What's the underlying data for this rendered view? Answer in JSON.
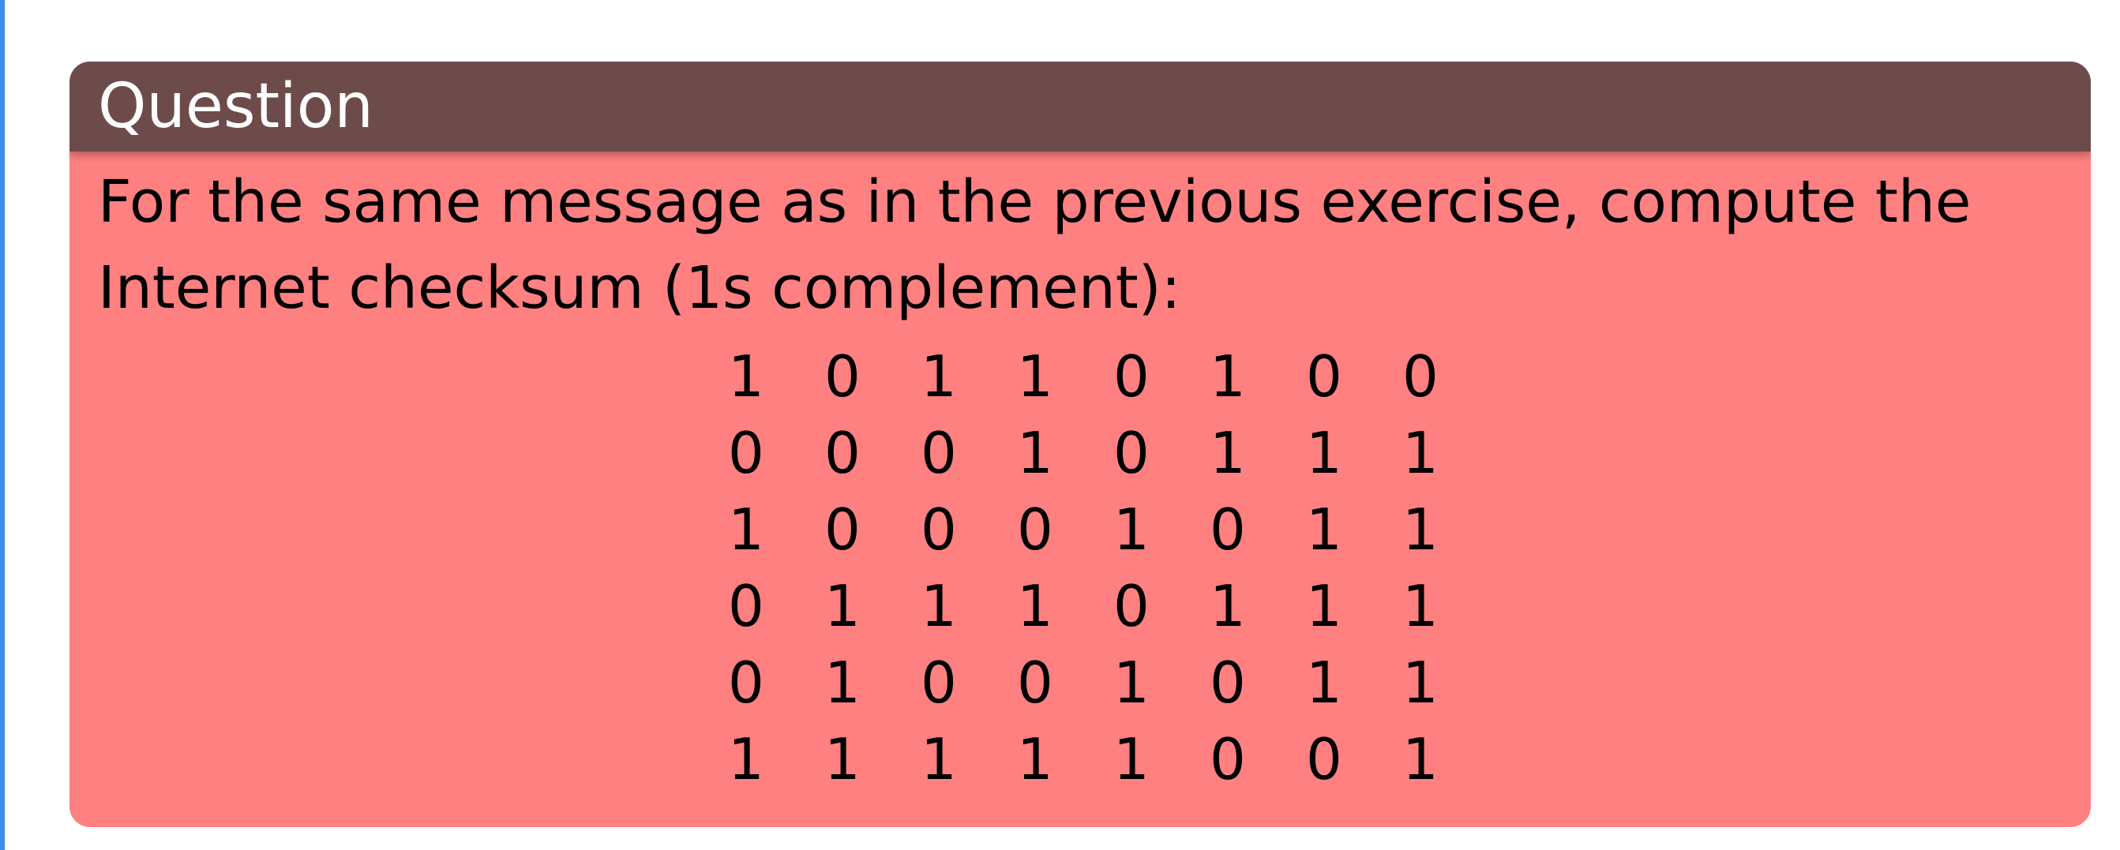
{
  "block": {
    "title": "Question",
    "text": "For the same message as in the previous exercise, compute the Internet checksum (1s complement):",
    "matrix": [
      [
        "1",
        "0",
        "1",
        "1",
        "0",
        "1",
        "0",
        "0"
      ],
      [
        "0",
        "0",
        "0",
        "1",
        "0",
        "1",
        "1",
        "1"
      ],
      [
        "1",
        "0",
        "0",
        "0",
        "1",
        "0",
        "1",
        "1"
      ],
      [
        "0",
        "1",
        "1",
        "1",
        "0",
        "1",
        "1",
        "1"
      ],
      [
        "0",
        "1",
        "0",
        "0",
        "1",
        "0",
        "1",
        "1"
      ],
      [
        "1",
        "1",
        "1",
        "1",
        "1",
        "0",
        "0",
        "1"
      ]
    ]
  },
  "colors": {
    "header": "#6e4b4b",
    "body": "#ff8080",
    "left_rule": "#3a8ee6"
  }
}
